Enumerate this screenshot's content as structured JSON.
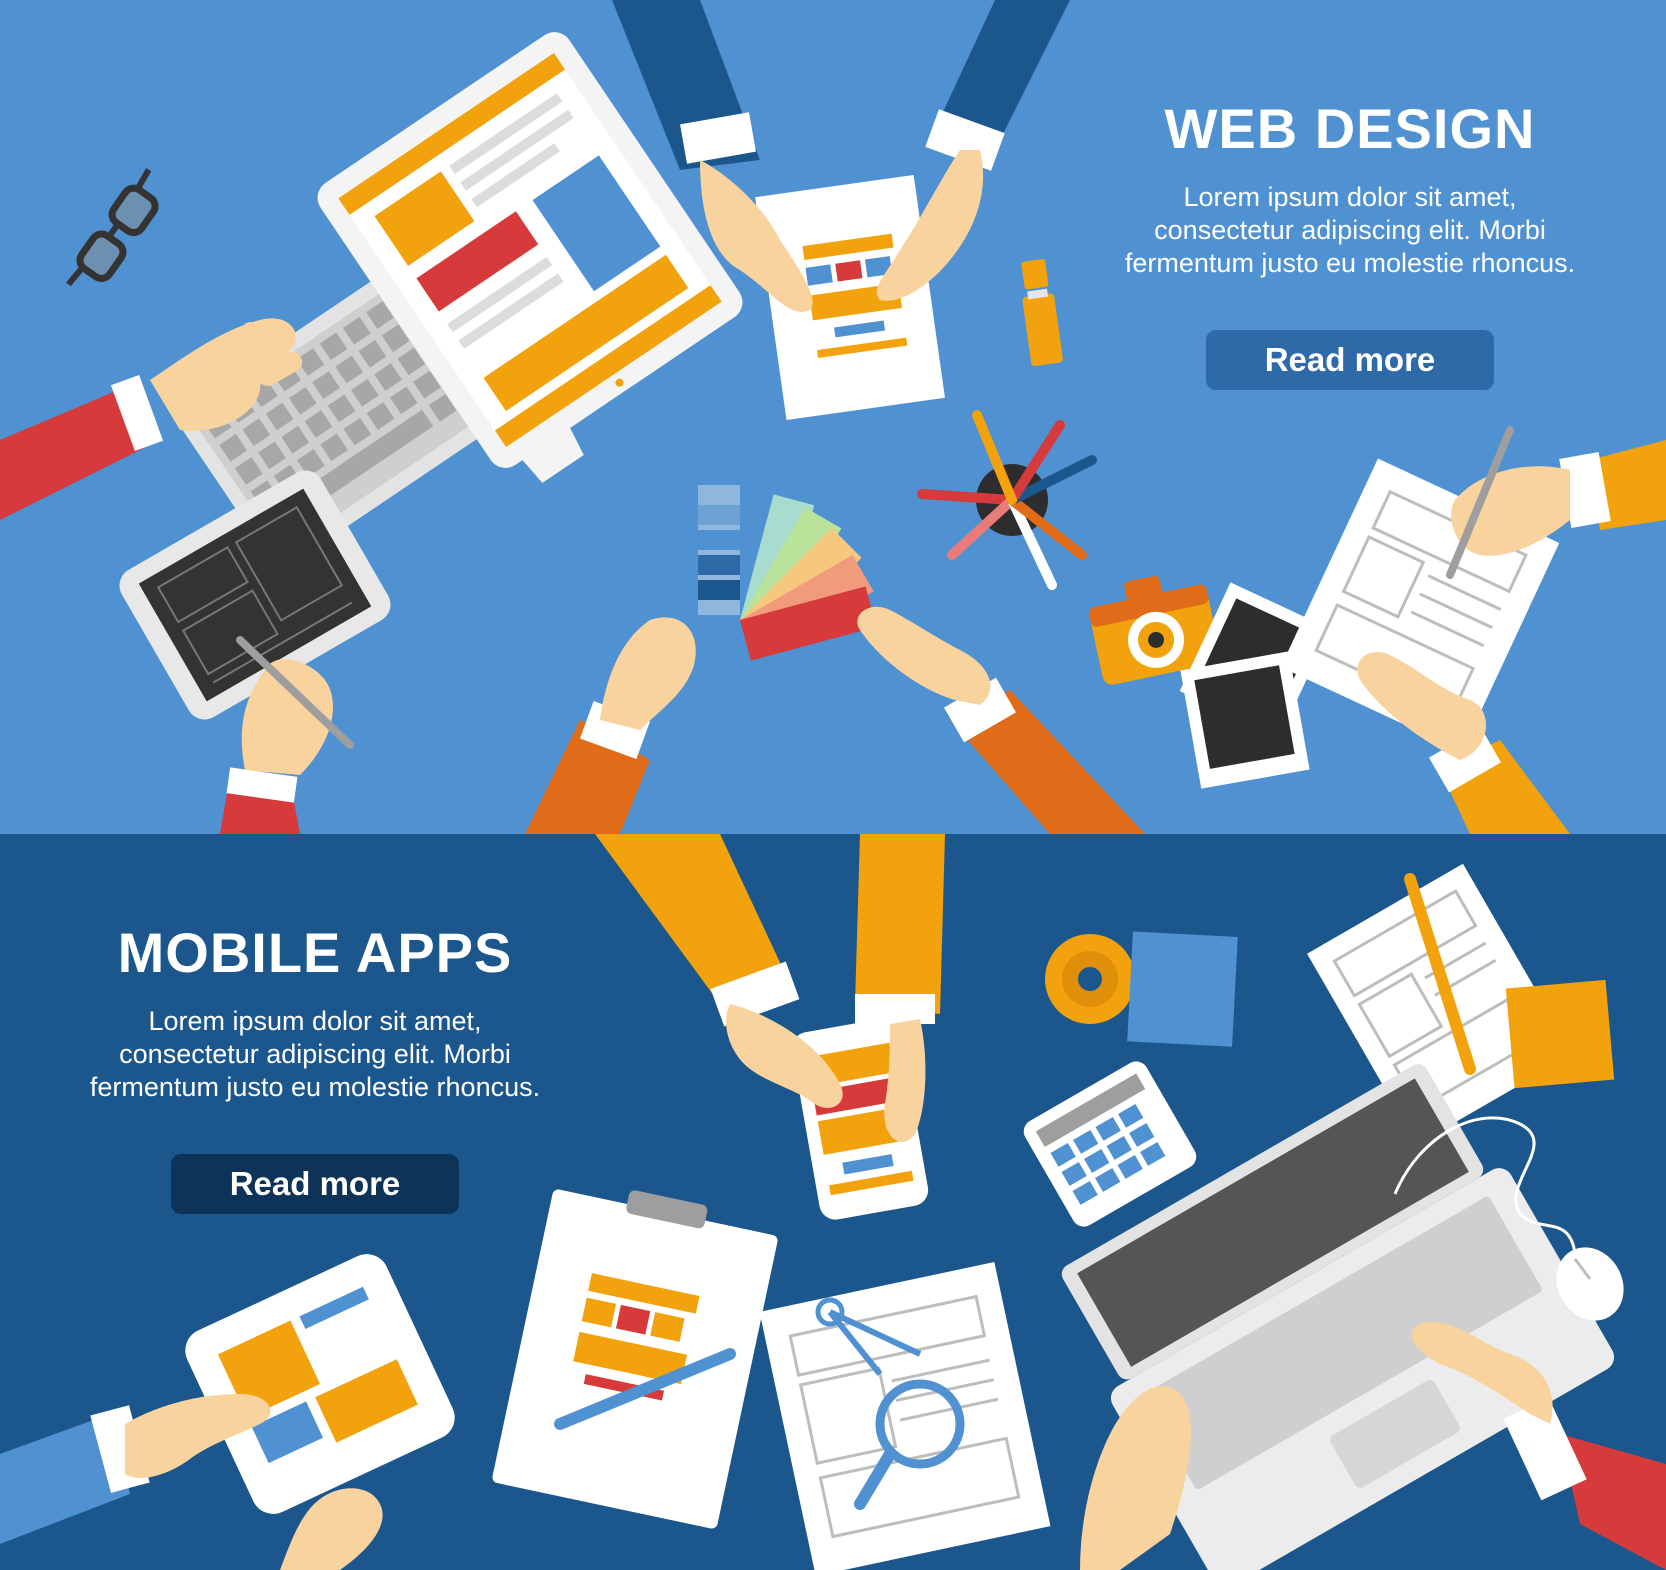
{
  "colors": {
    "top_background": "#4f91d1",
    "bottom_background": "#1b578c",
    "top_button": "#2e6aa8",
    "bottom_button": "#0e3358",
    "accent_orange": "#f2a20c",
    "accent_red": "#d63a3a",
    "text": "#ffffff"
  },
  "web_design": {
    "title": "WEB DESIGN",
    "body": "Lorem ipsum dolor sit amet, consectetur adipiscing elit. Morbi fermentum justo eu molestie rhoncus.",
    "button_label": "Read more",
    "illustration_icons": [
      "glasses-icon",
      "keyboard-icon",
      "monitor-icon",
      "tablet-icon",
      "wireframe-sheet-icon",
      "highlighter-icon",
      "pencil-cup-icon",
      "color-swatch-icon",
      "camera-icon",
      "photo-prints-icon",
      "sketch-paper-icon"
    ]
  },
  "mobile_apps": {
    "title": "MOBILE APPS",
    "body": "Lorem ipsum dolor sit amet, consectetur adipiscing elit. Morbi fermentum justo eu molestie rhoncus.",
    "button_label": "Read more",
    "illustration_icons": [
      "smartphone-icon",
      "disc-icon",
      "sticky-note-icon",
      "notebook-icon",
      "calculator-icon",
      "laptop-icon",
      "mouse-icon",
      "clipboard-icon",
      "pen-icon",
      "blueprint-icon",
      "magnifier-icon",
      "compass-icon",
      "tablet-icon"
    ]
  }
}
